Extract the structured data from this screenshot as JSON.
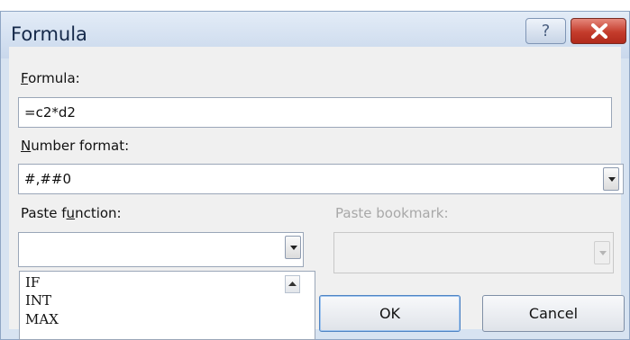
{
  "window": {
    "title": "Formula",
    "help_glyph": "?",
    "close_icon": "close-icon"
  },
  "formula": {
    "label_underlined": "F",
    "label_rest": "ormula:",
    "value": "=c2*d2"
  },
  "number_format": {
    "label_underlined": "N",
    "label_rest": "umber format:",
    "value": "#,##0"
  },
  "paste_function": {
    "label_before": "Paste f",
    "label_underlined": "u",
    "label_after": "nction:",
    "value": ""
  },
  "function_list": {
    "items": [
      "IF",
      "INT",
      "MAX"
    ]
  },
  "paste_bookmark": {
    "label": "Paste bookmark:",
    "value": ""
  },
  "buttons": {
    "ok": "OK",
    "cancel": "Cancel"
  }
}
